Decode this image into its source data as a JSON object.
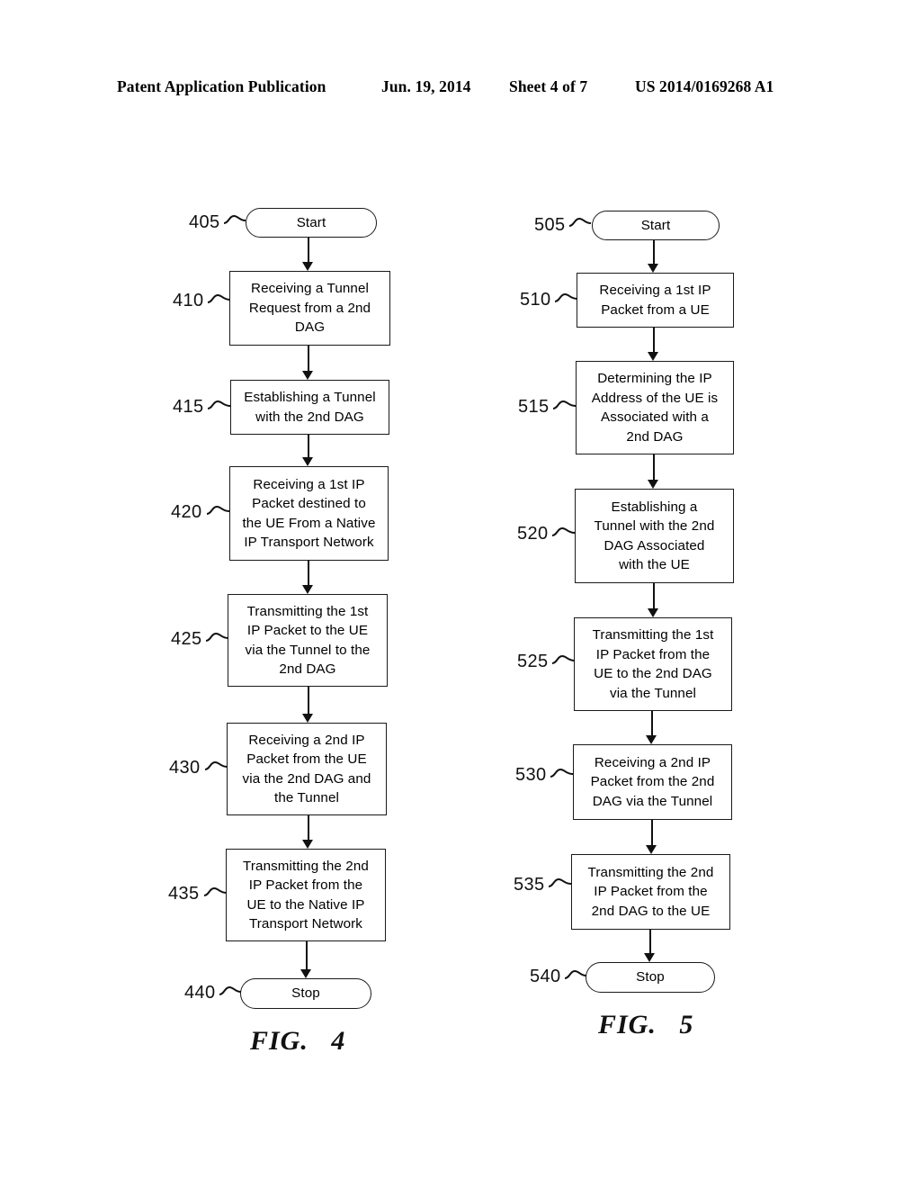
{
  "header": {
    "publication": "Patent Application Publication",
    "date": "Jun. 19, 2014",
    "sheet": "Sheet 4 of 7",
    "patent_number": "US 2014/0169268 A1"
  },
  "figures": [
    {
      "caption": "FIG.   4",
      "nodes": [
        {
          "ref": "405",
          "label": "Start",
          "shape": "terminal"
        },
        {
          "ref": "410",
          "label": "Receiving a Tunnel\nRequest from a 2nd\nDAG",
          "shape": "process"
        },
        {
          "ref": "415",
          "label": "Establishing a Tunnel\nwith the 2nd DAG",
          "shape": "process"
        },
        {
          "ref": "420",
          "label": "Receiving a 1st IP\nPacket destined to\nthe UE From a Native\nIP Transport Network",
          "shape": "process"
        },
        {
          "ref": "425",
          "label": "Transmitting the 1st\nIP Packet to the UE\nvia the Tunnel to the\n2nd DAG",
          "shape": "process"
        },
        {
          "ref": "430",
          "label": "Receiving a 2nd IP\nPacket from the UE\nvia the 2nd DAG and\nthe Tunnel",
          "shape": "process"
        },
        {
          "ref": "435",
          "label": "Transmitting the 2nd\nIP Packet from the\nUE to the Native IP\nTransport Network",
          "shape": "process"
        },
        {
          "ref": "440",
          "label": "Stop",
          "shape": "terminal"
        }
      ]
    },
    {
      "caption": "FIG.   5",
      "nodes": [
        {
          "ref": "505",
          "label": "Start",
          "shape": "terminal"
        },
        {
          "ref": "510",
          "label": "Receiving a 1st IP\nPacket from a UE",
          "shape": "process"
        },
        {
          "ref": "515",
          "label": "Determining the IP\nAddress of the UE is\nAssociated with a\n2nd DAG",
          "shape": "process"
        },
        {
          "ref": "520",
          "label": "Establishing a\nTunnel with the 2nd\nDAG Associated\nwith the UE",
          "shape": "process"
        },
        {
          "ref": "525",
          "label": "Transmitting the 1st\nIP Packet from the\nUE to the 2nd DAG\nvia the Tunnel",
          "shape": "process"
        },
        {
          "ref": "530",
          "label": "Receiving a 2nd IP\nPacket from the 2nd\nDAG via the Tunnel",
          "shape": "process"
        },
        {
          "ref": "535",
          "label": "Transmitting the 2nd\nIP Packet from the\n2nd DAG to the UE",
          "shape": "process"
        },
        {
          "ref": "540",
          "label": "Stop",
          "shape": "terminal"
        }
      ]
    }
  ]
}
